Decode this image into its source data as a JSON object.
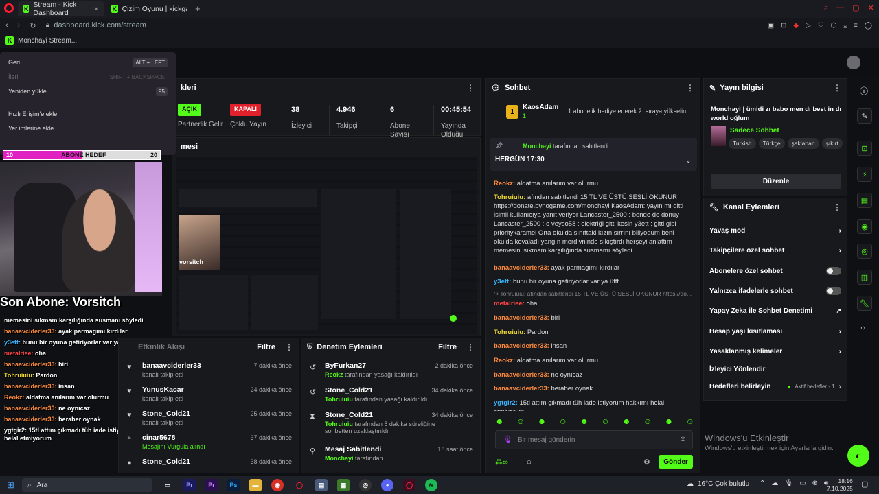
{
  "browser": {
    "tabs": [
      {
        "label": "Stream - Kick Dashboard",
        "close": "✕"
      },
      {
        "label": "Çizim Oyunu | kickgames",
        "close": "✕"
      }
    ],
    "new_tab": "+",
    "url": "dashboard.kick.com/stream",
    "bookmark": "Monchayi Stream..."
  },
  "context_menu": {
    "items": [
      {
        "label": "Geri",
        "shortcut": "ALT + LEFT"
      },
      {
        "label": "İleri",
        "shortcut": "SHIFT + BACKSPACE"
      },
      {
        "label": "Yeniden yükle",
        "shortcut": "F5"
      },
      {
        "label": "Hızlı Erişim'e ekle",
        "shortcut": ""
      },
      {
        "label": "Yer imlerine ekle...",
        "shortcut": ""
      }
    ]
  },
  "goal": {
    "left": "10",
    "label": "ABONE HEDEF",
    "right": "20",
    "progress": 0.5
  },
  "overlay": {
    "last_sub": "Son Abone: Vorsitch",
    "chat": [
      {
        "user": "",
        "text": "memesini sıkmam karşılığında susmanı söyledi"
      },
      {
        "user": "banaavciderler33:",
        "text": "ayak parmagımı kırdılar"
      },
      {
        "user": "y3ett:",
        "text": "bunu bir oyuna getiriyorlar var ya üfff"
      },
      {
        "user": "metalriee:",
        "text": "oha"
      },
      {
        "user": "banaavciderler33:",
        "text": "biri"
      },
      {
        "user": "Tohruiuiu:",
        "text": "Pardon"
      },
      {
        "user": "banaavciderler33:",
        "text": "insan"
      },
      {
        "user": "Reokz:",
        "text": "aldatma anılarım var olurmu"
      },
      {
        "user": "banaavciderler33:",
        "text": "ne oynıcaz"
      },
      {
        "user": "banaavciderler33:",
        "text": "beraber oynak"
      },
      {
        "user": "ygtgir2:",
        "text": "15tl attım çıkmadı tüh iade istiyorum hakkımı helal etmiyorum"
      }
    ]
  },
  "stats": {
    "header": "kleri",
    "acik": "AÇIK",
    "acik_label": "Partnerlik Gelir",
    "kapali": "KAPALI",
    "kapali_label": "Çoklu Yayın",
    "viewers": "38",
    "viewers_label": "İzleyici",
    "followers": "4.946",
    "followers_label": "Takipçi",
    "subs": "6",
    "subs_label": "Abone Sayısı",
    "uptime": "00:45:54",
    "uptime_label": "Yayında Olduğu"
  },
  "preview": {
    "header": "mesi",
    "name_tag": "vorsitch"
  },
  "activity": {
    "title": "Etkinlik Akışı",
    "filter": "Filtre",
    "rows": [
      {
        "name": "banaavciderler33",
        "sub": "kanalı takip etti",
        "time": "7 dakika önce"
      },
      {
        "name": "YunusKacar",
        "sub": "kanalı takip etti",
        "time": "24 dakika önce"
      },
      {
        "name": "Stone_Cold21",
        "sub": "kanalı takip etti",
        "time": "25 dakika önce"
      },
      {
        "name": "cinar5678",
        "sub": "Mesajını Vurgula alındı",
        "time": "37 dakika önce"
      },
      {
        "name": "Stone_Cold21",
        "sub": "",
        "time": "38 dakika önce"
      }
    ]
  },
  "moderation": {
    "title": "Denetim Eylemleri",
    "filter": "Filtre",
    "rows": [
      {
        "name": "ByFurkan27",
        "actor": "Reokz",
        "sub": "tarafından yasağı kaldırıldı",
        "time": "2 dakika önce"
      },
      {
        "name": "Stone_Cold21",
        "actor": "Tohruiuiu",
        "sub": "tarafından yasağı kaldırıldı",
        "time": "34 dakika önce"
      },
      {
        "name": "Stone_Cold21",
        "actor": "Tohruiuiu",
        "sub": "tarafından 5 dakika süreliğine sohbetten uzaklaştırıldı",
        "time": "34 dakika önce"
      },
      {
        "name": "Mesaj Sabitlendi",
        "actor": "Monchayi",
        "sub": "tarafından",
        "time": "18 saat önce"
      }
    ]
  },
  "chat": {
    "title": "Sohbet",
    "gift_user": "KaosAdam",
    "gift_rank": "1",
    "gift_text": "1 abonelik hediye ederek 2. sıraya yükselin",
    "pinned_by": "Monchayi",
    "pinned_suffix": "tarafından sabitlendi",
    "pinned_text": "HERGÜN 17:30",
    "messages": [
      {
        "user": "Reokz:",
        "text": "aldatma anılarım var olurmu"
      },
      {
        "user": "Tohruiuiu:",
        "text": "afından sabitlendi 15 TL VE ÜSTÜ SESLİ OKUNUR https://donate.bynogame.com/monchayi KaosAdam: yayın mı gitti isimli kullanıcıya yanıt veriyor Lancaster_2500 : bende de donuy Lancaster_2500 : o veyso58 : elektriği gitti kesin y3ett : gitti gibi prioritykaramel Orta okulda sınıftaki kızın sırrını biliyodum beni okulda kovaladı yangın merdivninde sıkıştırdı herşeyi anlattım memesini sıkmam karşılığında susmamı söyledi"
      },
      {
        "user": "banaavciderler33:",
        "text": "ayak parmagımı kırdılar"
      },
      {
        "user": "y3ett:",
        "text": "bunu bir oyuna getiriyorlar var ya üfff"
      },
      {
        "user": "metalriee:",
        "text": "oha",
        "reply": "Tohruiuiu: afından sabitlendi 15 TL VE ÜSTÜ SESLİ OKUNUR https://do..."
      },
      {
        "user": "banaavciderler33:",
        "text": "biri"
      },
      {
        "user": "Tohruiuiu:",
        "text": "Pardon"
      },
      {
        "user": "banaavciderler33:",
        "text": "insan"
      },
      {
        "user": "Reokz:",
        "text": "aldatma anılarım var olurmu"
      },
      {
        "user": "banaavciderler33:",
        "text": "ne oynıcaz"
      },
      {
        "user": "banaavciderler33:",
        "text": "beraber oynak"
      },
      {
        "user": "ygtgir2:",
        "text": "15tl attım çıkmadı tüh iade istiyorum hakkımı helal etmiyorum"
      }
    ],
    "placeholder": "Bir mesaj gönderin",
    "send": "Gönder"
  },
  "stream_info": {
    "title": "Yayın bilgisi",
    "stream_title": "Monchayi | ümidi zı babo men dı best in dı world oğlum",
    "category": "Sadece Sohbet",
    "tags": [
      "Turkish",
      "Türkçe",
      "şaklaban",
      "şıkırt"
    ],
    "edit": "Düzenle"
  },
  "channel_actions": {
    "title": "Kanal Eylemleri",
    "rows": [
      {
        "label": "Yavaş mod",
        "kind": "arrow"
      },
      {
        "label": "Takipçilere özel sohbet",
        "kind": "arrow"
      },
      {
        "label": "Abonelere özel sohbet",
        "kind": "toggle"
      },
      {
        "label": "Yalnızca ifadelerle sohbet",
        "kind": "toggle"
      },
      {
        "label": "Yapay Zeka ile Sohbet Denetimi",
        "kind": "ext"
      },
      {
        "label": "Hesap yaşı kısıtlaması",
        "kind": "arrow"
      },
      {
        "label": "Yasaklanmış kelimeler",
        "kind": "arrow"
      },
      {
        "label": "İzleyici Yönlendir",
        "kind": "none"
      },
      {
        "label": "Hedefleri belirleyin",
        "kind": "arrow",
        "note": "Aktif hedefler - 1"
      }
    ]
  },
  "watermark": {
    "line1": "Windows'u Etkinleştir",
    "line2": "Windows'u etkinleştirmek için Ayarlar'a gidin."
  },
  "taskbar": {
    "search": "Ara",
    "weather": "16°C  Çok bulutlu",
    "time": "18:16",
    "date": "7.10.2025"
  },
  "colors": {
    "kick_green": "#53fc18",
    "goal_pink": "#e020c0",
    "panel": "#18191d"
  }
}
